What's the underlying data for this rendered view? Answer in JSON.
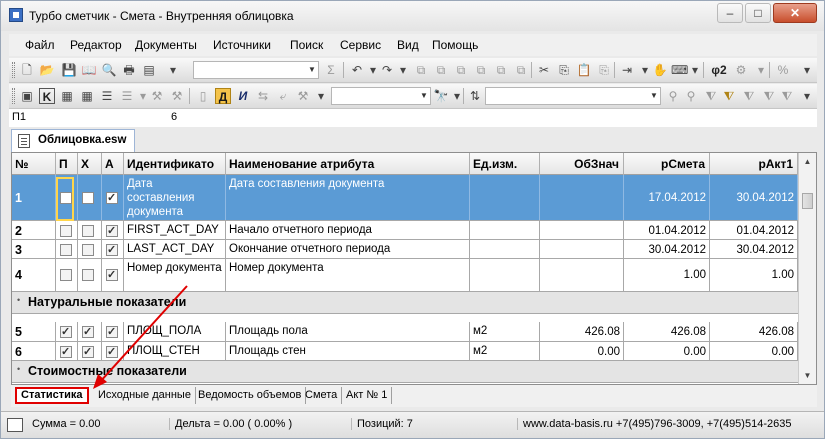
{
  "window": {
    "title": "Турбо сметчик - Смета - Внутренняя облицовка"
  },
  "menu": [
    "Файл",
    "Редактор",
    "Документы",
    "Источники",
    "Поиск",
    "Сервис",
    "Вид",
    "Помощь"
  ],
  "toolbar2": {
    "format_bold": "Д",
    "format_italic": "И"
  },
  "formula": {
    "cell_ref": "П1",
    "value": "6"
  },
  "document_tab": "Облицовка.esw",
  "grid": {
    "headers": [
      "№",
      "П",
      "Х",
      "А",
      "Идентификато",
      "Наименование атрибута",
      "Ед.изм.",
      "ОбЗнач",
      "рСмета",
      "рАкт1"
    ],
    "rows": [
      {
        "n": "1",
        "p": false,
        "x": false,
        "a": true,
        "id": "Дата составления документа",
        "name": "Дата составления документа",
        "unit": "",
        "ob": "",
        "smeta": "17.04.2012",
        "akt": "30.04.2012",
        "selected": true
      },
      {
        "n": "2",
        "p": false,
        "x": false,
        "a": true,
        "id": "FIRST_ACT_DAY",
        "name": "Начало отчетного периода",
        "unit": "",
        "ob": "",
        "smeta": "01.04.2012",
        "akt": "01.04.2012"
      },
      {
        "n": "3",
        "p": false,
        "x": false,
        "a": true,
        "id": "LAST_ACT_DAY",
        "name": "Окончание отчетного периода",
        "unit": "",
        "ob": "",
        "smeta": "30.04.2012",
        "akt": "30.04.2012"
      },
      {
        "n": "4",
        "p": false,
        "x": false,
        "a": true,
        "id": "Номер документа",
        "name": "Номер документа",
        "unit": "",
        "ob": "",
        "smeta": "1.00",
        "akt": "1.00"
      }
    ],
    "group1": "Натуральные показатели",
    "rows2": [
      {
        "n": "5",
        "p": true,
        "x": true,
        "a": true,
        "id": "ПЛОЩ_ПОЛА",
        "name": "Площадь пола",
        "unit": "м2",
        "ob": "426.08",
        "smeta": "426.08",
        "akt": "426.08"
      },
      {
        "n": "6",
        "p": true,
        "x": true,
        "a": true,
        "id": "ПЛОЩ_СТЕН",
        "name": "Площадь стен",
        "unit": "м2",
        "ob": "0.00",
        "smeta": "0.00",
        "akt": "0.00"
      }
    ],
    "group2": "Стоимостные показатели"
  },
  "sheet_tabs": [
    "Статистика",
    "Исходные данные",
    "Ведомость объемов",
    "Смета",
    "Акт № 1"
  ],
  "status": {
    "sum": "Сумма = 0.00",
    "delta": "Дельта = 0.00 ( 0.00% )",
    "position": "Позиций: 7",
    "contacts": "www.data-basis.ru  +7(495)796-3009, +7(495)514-2635"
  },
  "colors": {
    "selection": "#5b9bd5",
    "annotation": "#e00000"
  }
}
